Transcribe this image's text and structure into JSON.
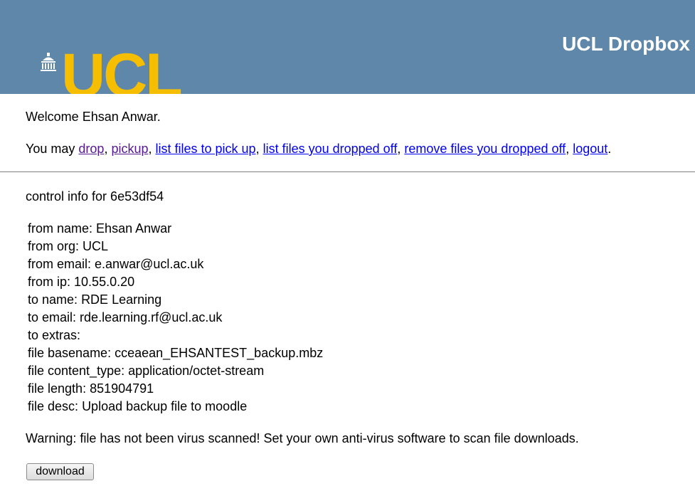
{
  "header": {
    "site_title": "UCL Dropbox",
    "logo_text": "UCL"
  },
  "welcome": {
    "prefix": "Welcome",
    "user_name": "Ehsan Anwar",
    "suffix": "."
  },
  "nav": {
    "intro": "You may",
    "links": [
      {
        "label": "drop",
        "visited": true
      },
      {
        "label": "pickup",
        "visited": true
      },
      {
        "label": "list files to pick up",
        "visited": false
      },
      {
        "label": "list files you dropped off",
        "visited": false
      },
      {
        "label": "remove files you dropped off",
        "visited": false
      },
      {
        "label": "logout",
        "visited": false
      }
    ]
  },
  "control": {
    "title": "control info for 6e53df54",
    "fields": [
      {
        "label": "from name",
        "value": "Ehsan Anwar"
      },
      {
        "label": "from org",
        "value": "UCL"
      },
      {
        "label": "from email",
        "value": "e.anwar@ucl.ac.uk"
      },
      {
        "label": "from ip",
        "value": "10.55.0.20"
      },
      {
        "label": "to name",
        "value": "RDE Learning"
      },
      {
        "label": "to email",
        "value": "rde.learning.rf@ucl.ac.uk"
      },
      {
        "label": "to extras",
        "value": ""
      },
      {
        "label": "file basename",
        "value": "cceaean_EHSANTEST_backup.mbz"
      },
      {
        "label": "file content_type",
        "value": "application/octet-stream"
      },
      {
        "label": "file length",
        "value": "851904791"
      },
      {
        "label": "file desc",
        "value": "Upload backup file to moodle"
      }
    ]
  },
  "warning": "Warning: file has not been virus scanned! Set your own anti-virus software to scan file downloads.",
  "download_label": "download",
  "colors": {
    "banner": "#5e87a9",
    "logo": "#f6be00",
    "link": "#0000ee",
    "link_visited": "#551a8b"
  }
}
